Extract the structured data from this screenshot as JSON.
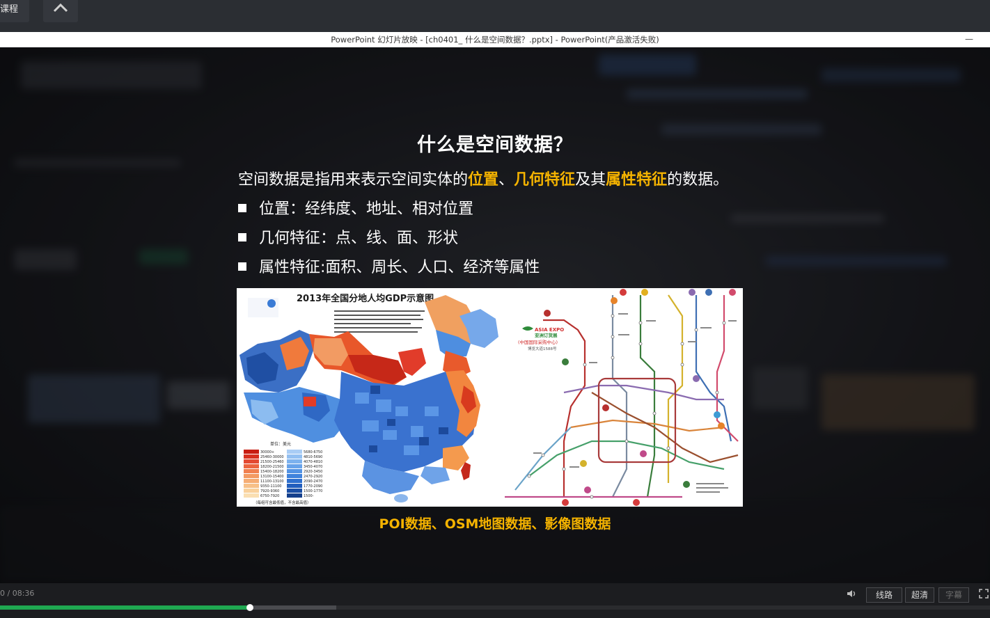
{
  "topbar": {
    "course_label": "课程",
    "collapse_icon": "chevron-up-icon"
  },
  "window": {
    "title": "PowerPoint 幻灯片放映 - [ch0401_ 什么是空间数据？.pptx] - PowerPoint(产品激活失败)",
    "minimize": "—"
  },
  "slide": {
    "title": "什么是空间数据？",
    "definition": {
      "p1": "空间数据是指用来表示空间实体的",
      "h1": "位置",
      "p2": "、",
      "h2": "几何特征",
      "p3": "及其",
      "h3": "属性特征",
      "p4": "的数据。"
    },
    "bullets": [
      "位置：经纬度、地址、相对位置",
      "几何特征：点、线、面、形状",
      "属性特征:面积、周长、人口、经济等属性"
    ],
    "figure": {
      "map_title": "2013年全国分地人均GDP示意图",
      "legend_unit": "单位：美元",
      "legend_left": [
        "30000+",
        "25460-30000",
        "21500-25460",
        "18200-21500",
        "15400-18200",
        "13100-15400",
        "11100-13100",
        "9350-11100",
        "7920-9360",
        "6750-7920"
      ],
      "legend_right": [
        "5680-6750",
        "4810-5690",
        "4070-4810",
        "3450-4070",
        "2920-3450",
        "2470-2920",
        "2090-2470",
        "1770-2090",
        "1500-1770",
        "1500-"
      ],
      "legend_note": "（每组可含最低值，不含最高值）",
      "expo_line1": "ASIA EXPO",
      "expo_line2": "亚洲订货展",
      "expo_line3": "(中国国际采购中心)",
      "expo_line4": "博览大道1588号"
    },
    "caption": "POI数据、OSM地图数据、影像图数据"
  },
  "player": {
    "time": "0 / 08:36",
    "buttons": {
      "route": "线路",
      "quality": "超清",
      "subtitle": "字幕"
    },
    "progress_fraction": 0.2525,
    "buffered_fraction": 0.34,
    "volume_icon": "speaker-icon",
    "fullscreen_icon": "fullscreen-icon"
  },
  "colors": {
    "highlight": "#f5b300",
    "progress": "#1fa851",
    "bar": "#1c1d20"
  }
}
